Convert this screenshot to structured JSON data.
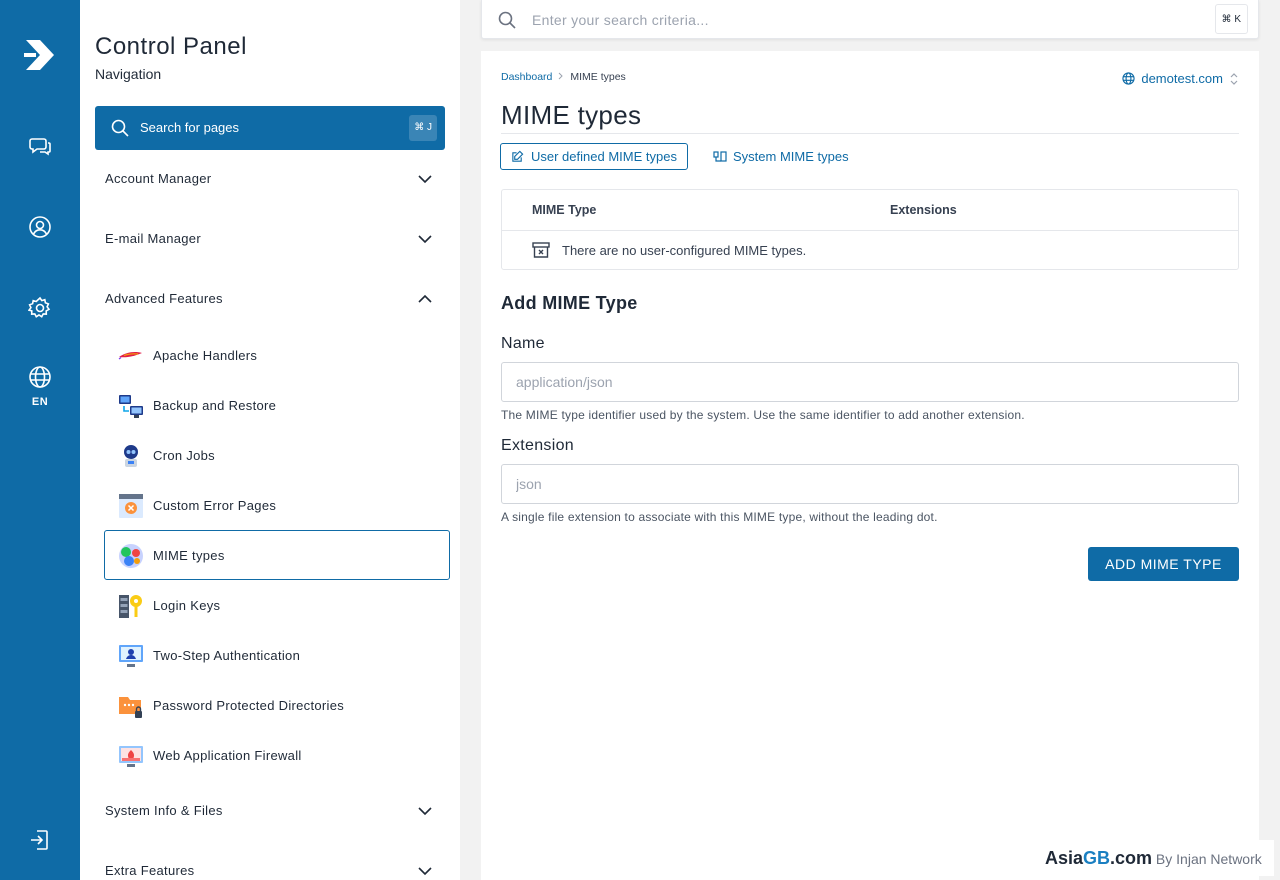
{
  "app": {
    "title": "Control Panel",
    "subtitle": "Navigation",
    "search_label": "Search for pages",
    "search_shortcut": "⌘ J",
    "lang": "EN"
  },
  "rail": {
    "icons": [
      "cpanel-logo-icon",
      "chat-icon",
      "user-icon",
      "gear-icon",
      "globe-icon",
      "logout-icon"
    ]
  },
  "sidebar": {
    "sections": [
      {
        "label": "Account Manager",
        "expanded": false
      },
      {
        "label": "E-mail Manager",
        "expanded": false
      },
      {
        "label": "Advanced Features",
        "expanded": true
      },
      {
        "label": "System Info & Files",
        "expanded": false
      },
      {
        "label": "Extra Features",
        "expanded": false
      }
    ],
    "items": [
      {
        "label": "Apache Handlers",
        "icon": "feather-icon"
      },
      {
        "label": "Backup and Restore",
        "icon": "backup-icon"
      },
      {
        "label": "Cron Jobs",
        "icon": "robot-icon"
      },
      {
        "label": "Custom Error Pages",
        "icon": "error-page-icon"
      },
      {
        "label": "MIME types",
        "icon": "mime-icon",
        "active": true
      },
      {
        "label": "Login Keys",
        "icon": "key-icon"
      },
      {
        "label": "Two-Step Authentication",
        "icon": "two-step-icon"
      },
      {
        "label": "Password Protected Directories",
        "icon": "locked-folder-icon"
      },
      {
        "label": "Web Application Firewall",
        "icon": "firewall-icon"
      }
    ]
  },
  "topsearch": {
    "placeholder": "Enter your search criteria...",
    "shortcut": "⌘ K"
  },
  "breadcrumb": {
    "root": "Dashboard",
    "current": "MIME types"
  },
  "domain": "demotest.com",
  "page": {
    "title": "MIME types",
    "tabs": [
      "User defined MIME types",
      "System MIME types"
    ]
  },
  "table": {
    "headers": [
      "MIME Type",
      "Extensions"
    ],
    "empty": "There are no user-configured MIME types."
  },
  "form": {
    "title": "Add MIME Type",
    "name_label": "Name",
    "name_placeholder": "application/json",
    "name_help": "The MIME type identifier used by the system. Use the same identifier to add another extension.",
    "ext_label": "Extension",
    "ext_placeholder": "json",
    "ext_help": "A single file extension to associate with this MIME type, without the leading dot.",
    "submit": "ADD MIME TYPE"
  },
  "brand": {
    "part1": "Asia",
    "part2": "GB",
    "part3": ".com",
    "tagline": " By Injan Network"
  },
  "colors": {
    "primary": "#0f6ba6",
    "background": "#f2f2f2"
  }
}
